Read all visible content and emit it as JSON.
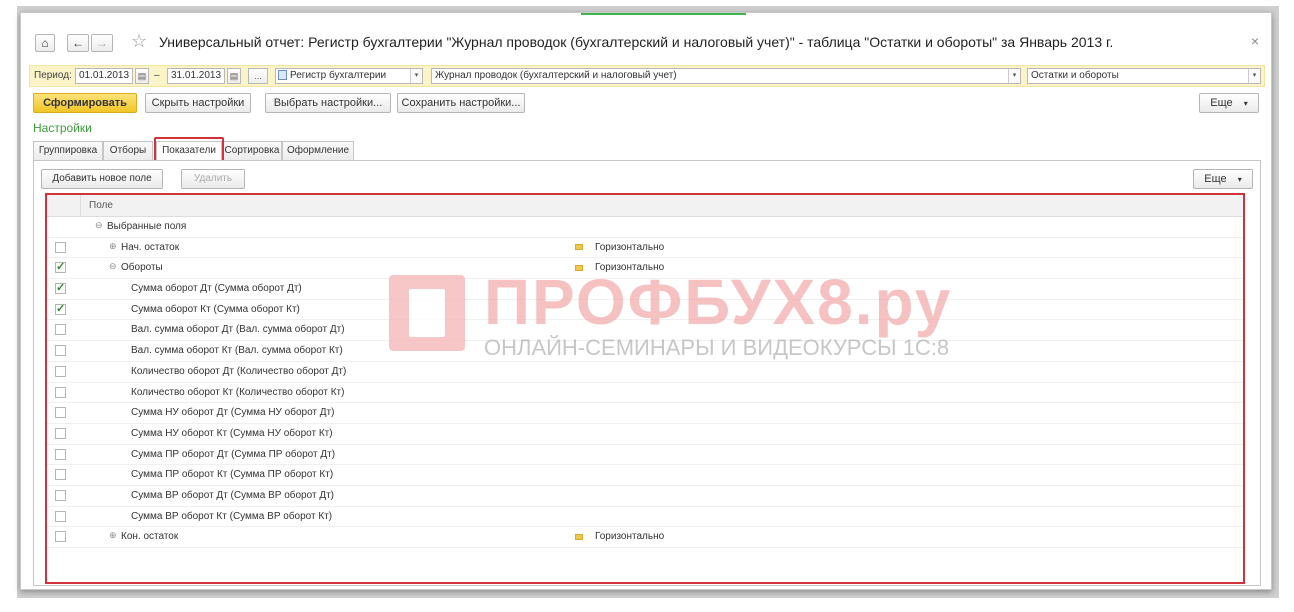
{
  "window": {
    "title": "Универсальный отчет: Регистр бухгалтерии \"Журнал проводок (бухгалтерский и налоговый учет)\" - таблица \"Остатки и обороты\" за Январь 2013 г.",
    "home_glyph": "⌂",
    "back_glyph": "←",
    "forward_glyph": "→",
    "star_glyph": "☆",
    "close_glyph": "×"
  },
  "params": {
    "period_label": "Период:",
    "date_from": "01.01.2013",
    "dash": "–",
    "date_to": "31.01.2013",
    "calendar_glyph": "▤",
    "ellipsis": "...",
    "source_type": "Регистр бухгалтерии",
    "register": "Журнал проводок (бухгалтерский и налоговый учет)",
    "table": "Остатки и обороты",
    "dropdown_glyph": "▾"
  },
  "toolbar": {
    "generate": "Сформировать",
    "hide_settings": "Скрыть настройки",
    "choose_settings": "Выбрать настройки...",
    "save_settings": "Сохранить настройки...",
    "more": "Еще"
  },
  "settings": {
    "title": "Настройки",
    "tabs": [
      "Группировка",
      "Отборы",
      "Показатели",
      "Сортировка",
      "Оформление"
    ],
    "active_tab": "Показатели",
    "add_field": "Добавить новое поле",
    "delete": "Удалить",
    "more": "Еще",
    "column_header": "Поле",
    "rows": [
      {
        "label": "Выбранные поля",
        "checked": null,
        "expander": "⊖",
        "layout": ""
      },
      {
        "label": "Нач. остаток",
        "checked": false,
        "expander": "⊕",
        "layout": "Горизонтально"
      },
      {
        "label": "Обороты",
        "checked": true,
        "expander": "⊖",
        "layout": "Горизонтально"
      },
      {
        "label": "Сумма оборот Дт (Сумма оборот Дт)",
        "checked": true,
        "expander": "",
        "layout": ""
      },
      {
        "label": "Сумма оборот Кт (Сумма оборот Кт)",
        "checked": true,
        "expander": "",
        "layout": ""
      },
      {
        "label": "Вал. сумма оборот Дт (Вал. сумма оборот Дт)",
        "checked": false,
        "expander": "",
        "layout": ""
      },
      {
        "label": "Вал. сумма оборот Кт (Вал. сумма оборот Кт)",
        "checked": false,
        "expander": "",
        "layout": ""
      },
      {
        "label": "Количество оборот Дт (Количество оборот Дт)",
        "checked": false,
        "expander": "",
        "layout": ""
      },
      {
        "label": "Количество оборот Кт (Количество оборот Кт)",
        "checked": false,
        "expander": "",
        "layout": ""
      },
      {
        "label": "Сумма НУ оборот Дт (Сумма НУ оборот Дт)",
        "checked": false,
        "expander": "",
        "layout": ""
      },
      {
        "label": "Сумма НУ оборот Кт (Сумма НУ оборот Кт)",
        "checked": false,
        "expander": "",
        "layout": ""
      },
      {
        "label": "Сумма ПР оборот Дт (Сумма ПР оборот Дт)",
        "checked": false,
        "expander": "",
        "layout": ""
      },
      {
        "label": "Сумма ПР оборот Кт (Сумма ПР оборот Кт)",
        "checked": false,
        "expander": "",
        "layout": ""
      },
      {
        "label": "Сумма ВР оборот Дт (Сумма ВР оборот Дт)",
        "checked": false,
        "expander": "",
        "layout": ""
      },
      {
        "label": "Сумма ВР оборот Кт (Сумма ВР оборот Кт)",
        "checked": false,
        "expander": "",
        "layout": ""
      },
      {
        "label": "Кон. остаток",
        "checked": false,
        "expander": "⊕",
        "layout": "Горизонтально"
      }
    ]
  },
  "watermark": {
    "brand": "ПРОФБУХ8.ру",
    "tagline": "ОНЛАЙН-СЕМИНАРЫ И ВИДЕОКУРСЫ 1С:8"
  },
  "colors": {
    "accent_green": "#3a9d3a",
    "highlight_red": "#d2323c",
    "primary_button": "#f2c527",
    "param_bar": "#fbf4c8"
  }
}
